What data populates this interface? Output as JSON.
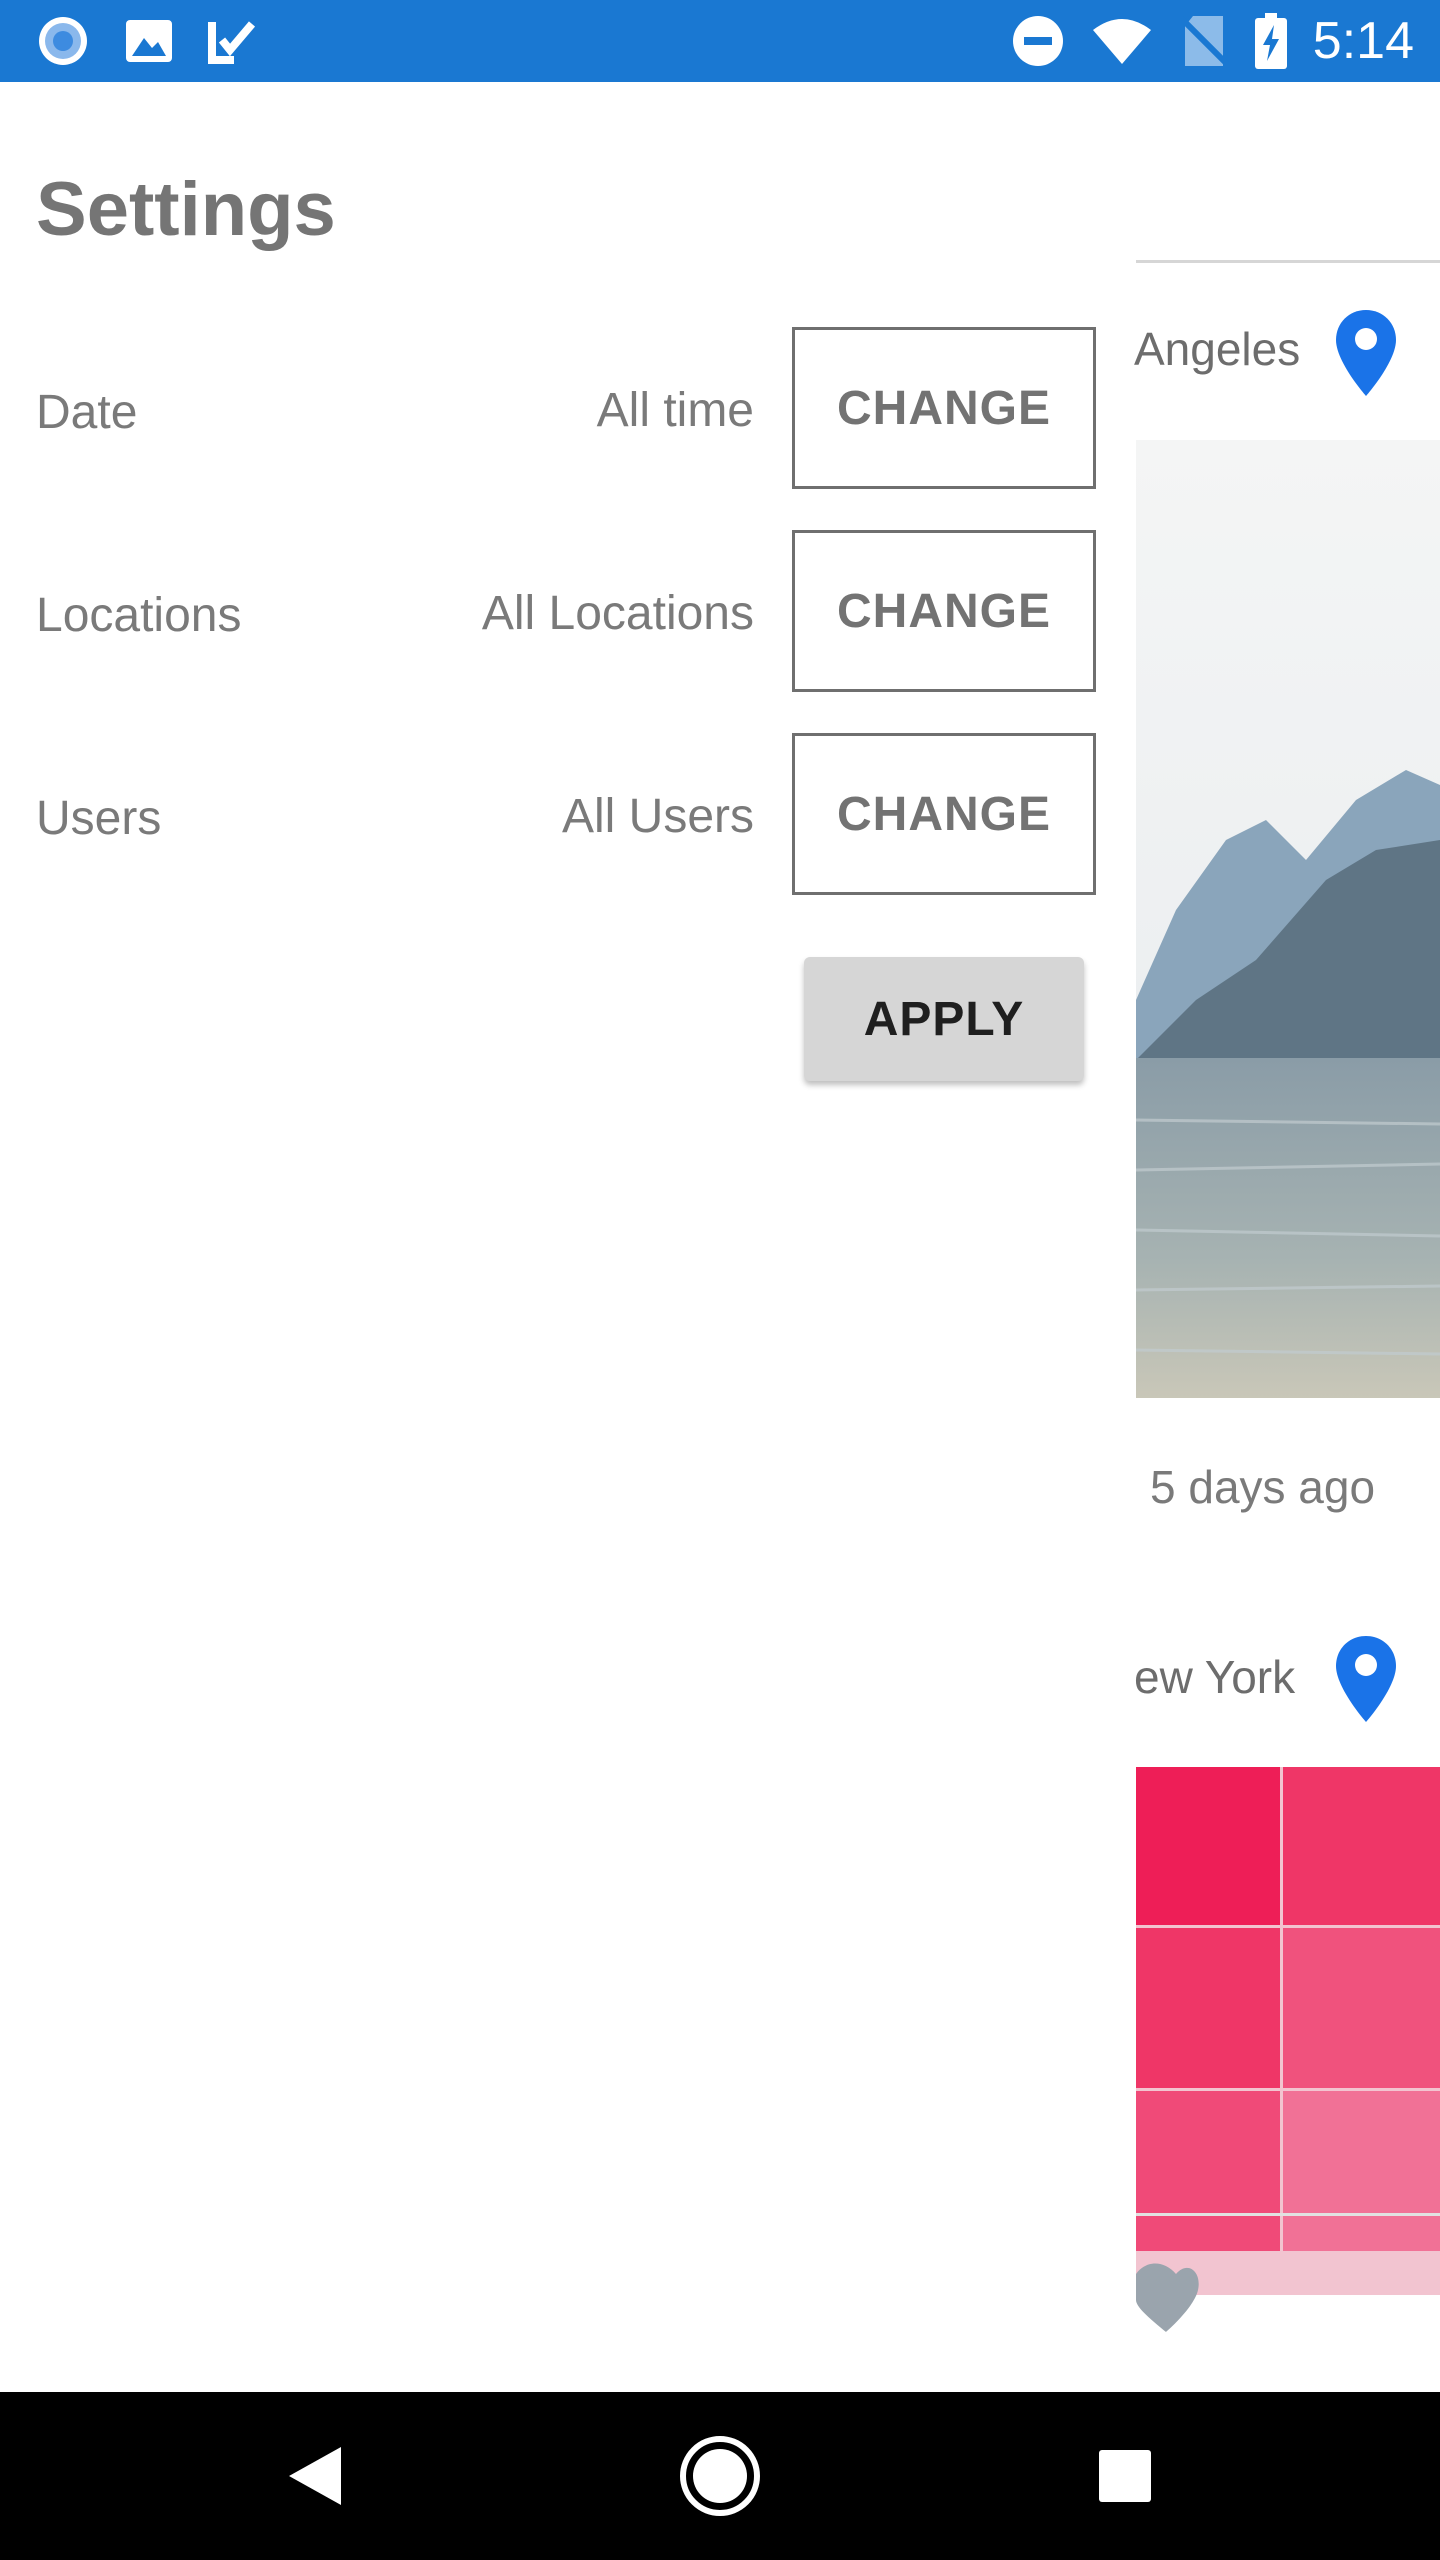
{
  "status_bar": {
    "time": "5:14",
    "color": "#1a78d2",
    "left_icons": [
      "record-icon",
      "image-icon",
      "task-check-icon"
    ],
    "right_icons": [
      "do-not-disturb-icon",
      "wifi-icon",
      "no-sim-icon",
      "battery-charging-icon"
    ]
  },
  "drawer": {
    "title": "Settings",
    "rows": [
      {
        "label": "Date",
        "value": "All time",
        "button": "CHANGE"
      },
      {
        "label": "Locations",
        "value": "All Locations",
        "button": "CHANGE"
      },
      {
        "label": "Users",
        "value": "All Users",
        "button": "CHANGE"
      }
    ],
    "apply_label": "APPLY"
  },
  "feed": {
    "posts": [
      {
        "location": "Angeles",
        "time": "5 days ago",
        "image": "mountain-lake-photo"
      },
      {
        "location": "ew York",
        "image": "pink-tiles-image"
      }
    ],
    "pin_color": "#1a73e8",
    "heart_color": "#9aa4ad"
  },
  "nav_bar": {
    "buttons": [
      "back-icon",
      "home-icon",
      "recents-icon"
    ]
  }
}
